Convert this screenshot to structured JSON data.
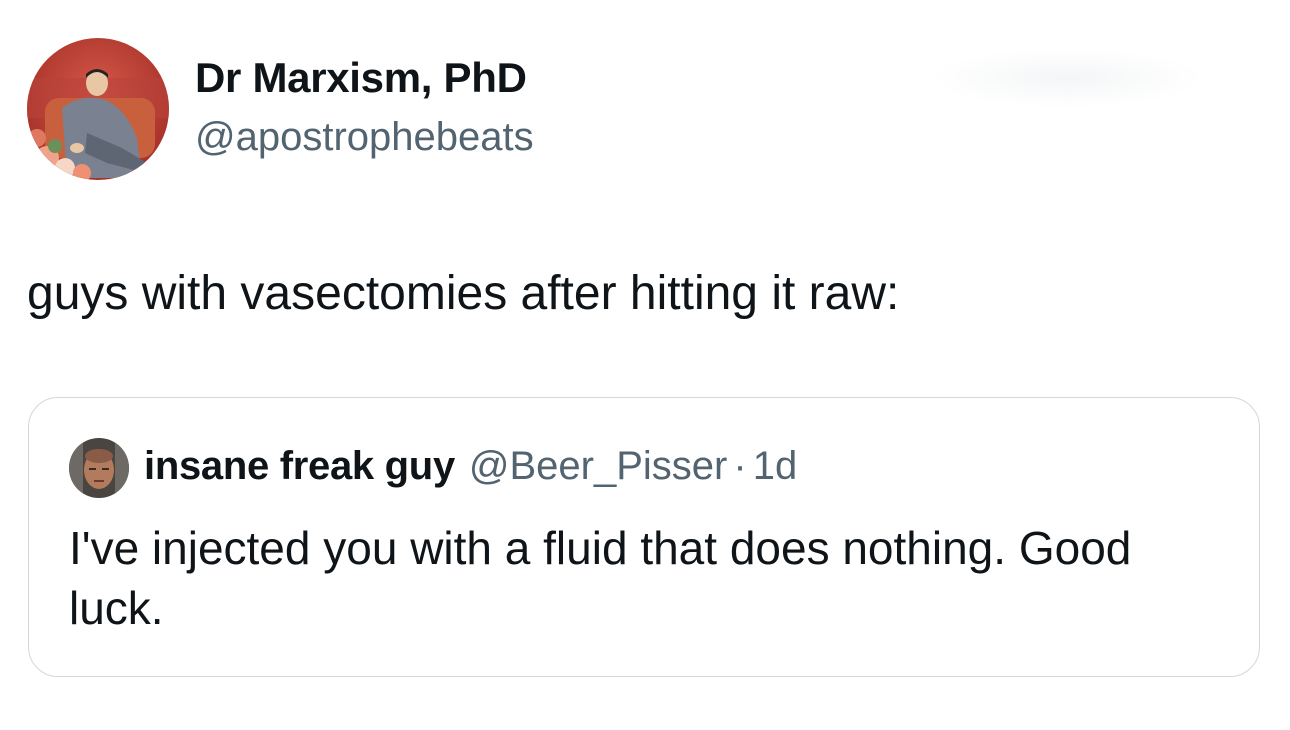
{
  "author": {
    "display_name": "Dr Marxism, PhD",
    "handle": "@apostrophebeats",
    "avatar_icon": "portrait-avatar-icon"
  },
  "tweet": {
    "text": "guys with vasectomies after hitting it raw:"
  },
  "quoted_tweet": {
    "display_name": "insane freak guy",
    "handle": "@Beer_Pisser",
    "separator": "·",
    "time": "1d",
    "text": "I've injected you with a fluid that does nothing. Good luck.",
    "avatar_icon": "face-avatar-icon"
  },
  "colors": {
    "text_primary": "#0f1419",
    "text_secondary": "#536471",
    "border": "#cfd9de",
    "background": "#ffffff"
  }
}
